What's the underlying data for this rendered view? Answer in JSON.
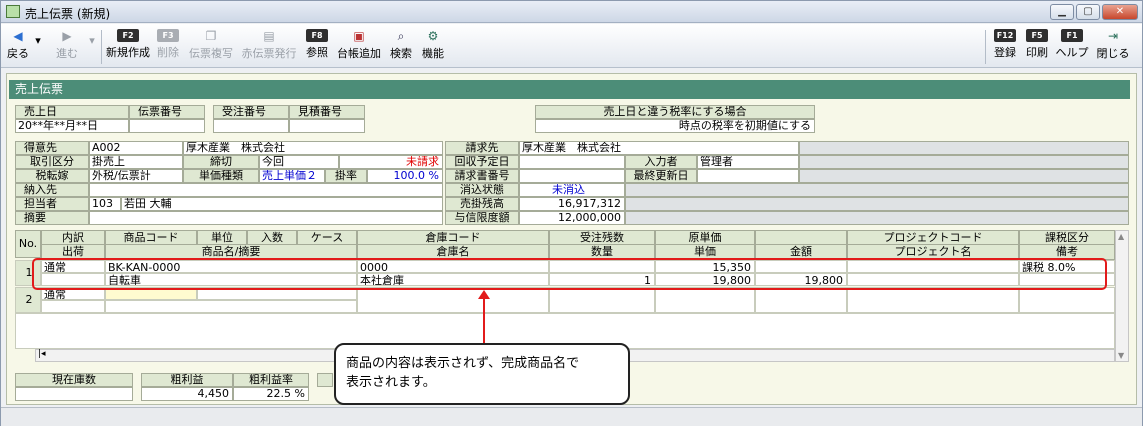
{
  "window": {
    "title": "売上伝票 (新規)"
  },
  "toolbar": {
    "back": "戻る",
    "forward": "進む",
    "new_fkey": "F2",
    "new": "新規作成",
    "del_fkey": "F3",
    "del": "削除",
    "copy": "伝票複写",
    "red": "赤伝票発行",
    "ref_fkey": "F8",
    "ref": "参照",
    "ledger": "台帳追加",
    "search": "検索",
    "func": "機能",
    "save_fkey": "F12",
    "save": "登録",
    "print_fkey": "F5",
    "print": "印刷",
    "help_fkey": "F1",
    "help": "ヘルプ",
    "close_fkey": "",
    "close": "閉じる"
  },
  "section": {
    "title": "売上伝票"
  },
  "head": {
    "date_label": "売上日",
    "date_value": "20**年**月**日",
    "slip_no_label": "伝票番号",
    "order_no_label": "受注番号",
    "estimate_no_label": "見積番号",
    "tax_label": "売上日と違う税率にする場合",
    "tax_value": "時点の税率を初期値にする"
  },
  "customer": {
    "label": "得意先",
    "code": "A002",
    "name": "厚木産業　株式会社",
    "billing_label": "請求先",
    "billing_name": "厚木産業　株式会社",
    "trade_label": "取引区分",
    "trade_value": "掛売上",
    "closing_label": "締切",
    "closing_value": "今回",
    "unbilled": "未請求",
    "collection_label": "回収予定日",
    "entry_label": "入力者",
    "entry_value": "管理者",
    "tax_mode_label": "税転嫁",
    "tax_mode_value": "外税/伝票計",
    "price_type_label": "単価種類",
    "price_type_value": "売上単価２",
    "rate_label": "掛率",
    "rate_value": "100.0 %",
    "invoice_no_label": "請求書番号",
    "updated_label": "最終更新日",
    "deliver_label": "納入先",
    "settle_label": "消込状態",
    "settle_value": "未消込",
    "staff_label": "担当者",
    "staff_code": "103",
    "staff_name": "若田 大輔",
    "balance_label": "売掛残高",
    "balance_value": "16,917,312",
    "summary_label": "摘要",
    "credit_label": "与信限度額",
    "credit_value": "12,000,000"
  },
  "grid": {
    "no": "No.",
    "h1": {
      "breakdown": "内訳",
      "product_code": "商品コード",
      "unit": "単位",
      "qty_in": "入数",
      "case": "ケース",
      "wh_code": "倉庫コード",
      "remaining": "受注残数",
      "cost": "原単価",
      "project_code": "プロジェクトコード",
      "tax_class": "課税区分"
    },
    "h2": {
      "ship": "出荷",
      "product_name": "商品名/摘要",
      "wh_name": "倉庫名",
      "qty": "数量",
      "price": "単価",
      "amount": "金額",
      "project_name": "プロジェクト名",
      "note": "備考"
    },
    "rows": [
      {
        "no": "1",
        "breakdown": "通常",
        "code": "BK-KAN-0000",
        "name": "自転車",
        "wh_code": "0000",
        "wh_name": "本社倉庫",
        "qty": "1",
        "cost": "15,350",
        "price": "19,800",
        "amount": "19,800",
        "tax": "課税 8.0%"
      },
      {
        "no": "2",
        "breakdown": "通常"
      }
    ]
  },
  "footer": {
    "stock_label": "現在庫数",
    "gross_label": "粗利益",
    "gross_value": "4,450",
    "gross_rate_label": "粗利益率",
    "gross_rate_value": "22.5 %"
  },
  "callout": {
    "line1": "商品の内容は表示されず、完成商品名で",
    "line2": "表示されます。"
  }
}
